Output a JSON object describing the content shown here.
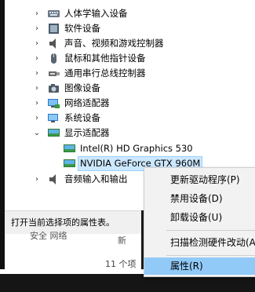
{
  "device_tree": [
    {
      "label": "人体学输入设备",
      "expander": "›",
      "icon": "hid-icon"
    },
    {
      "label": "软件设备",
      "expander": "›",
      "icon": "software-device-icon"
    },
    {
      "label": "声音、视频和游戏控制器",
      "expander": "›",
      "icon": "speaker-icon"
    },
    {
      "label": "鼠标和其他指针设备",
      "expander": "›",
      "icon": "mouse-icon"
    },
    {
      "label": "通用串行总线控制器",
      "expander": "›",
      "icon": "usb-icon"
    },
    {
      "label": "图像设备",
      "expander": "›",
      "icon": "camera-icon"
    },
    {
      "label": "网络适配器",
      "expander": "›",
      "icon": "network-adapter-icon"
    },
    {
      "label": "系统设备",
      "expander": "›",
      "icon": "system-device-icon"
    },
    {
      "label": "显示适配器",
      "expander": "⌄",
      "icon": "display-adapter-icon"
    },
    {
      "label": "Intel(R) HD Graphics 530",
      "expander": "",
      "icon": "display-adapter-icon"
    },
    {
      "label": "NVIDIA GeForce GTX 960M",
      "expander": "",
      "icon": "display-adapter-icon"
    },
    {
      "label": "音频输入和输出",
      "expander": "›",
      "icon": "audio-io-icon"
    }
  ],
  "status_bar": {
    "text": "打开当前选择项的属性表。"
  },
  "background": {
    "fragment": "安全 网络",
    "fragment2": "新",
    "count": "11 个项"
  },
  "context_menu": {
    "items": [
      "更新驱动程序(P)",
      "禁用设备(D)",
      "卸载设备(U)",
      "扫描检测硬件改动(A)",
      "属性(R)"
    ],
    "highlighted": "属性(R)"
  },
  "colors": {
    "selection": "#cce8ff",
    "menu_highlight": "#91c9f7",
    "menu_bg": "#f2f2f2"
  }
}
